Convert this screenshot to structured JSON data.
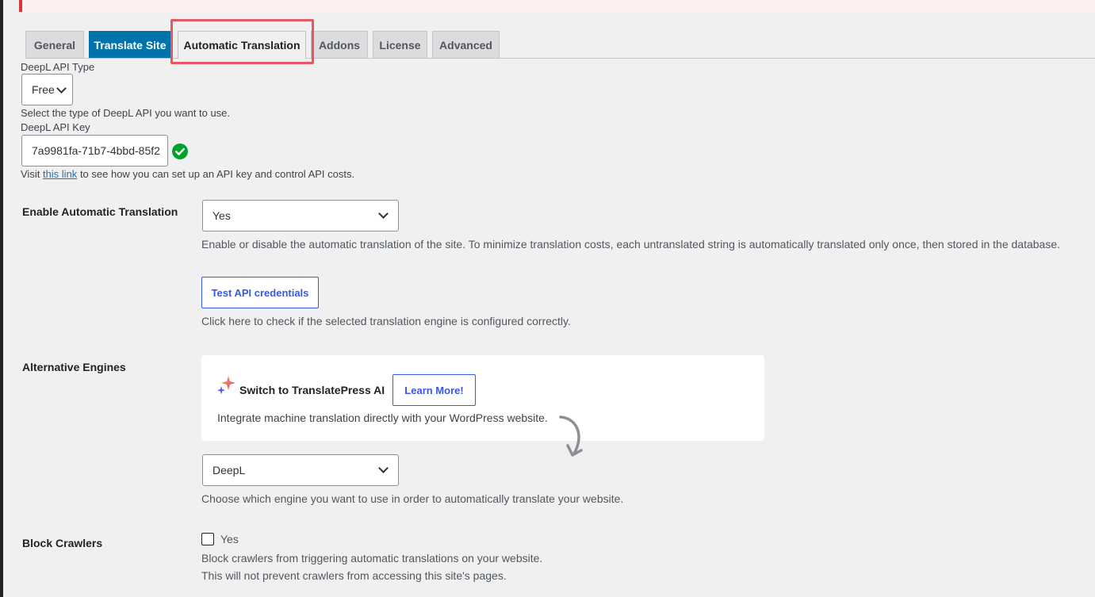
{
  "tabs": [
    {
      "label": "General"
    },
    {
      "label": "Translate Site"
    },
    {
      "label": "Automatic Translation"
    },
    {
      "label": "Addons"
    },
    {
      "label": "License"
    },
    {
      "label": "Advanced"
    }
  ],
  "active_tab": "Automatic Translation",
  "colors": {
    "accent": "#0073aa",
    "highlight": "#e65762",
    "button": "#3858e9",
    "success": "#00a32a"
  },
  "deepl": {
    "api_type_label": "DeepL API Type",
    "api_type_value": "Free",
    "api_type_help": "Select the type of DeepL API you want to use.",
    "api_key_label": "DeepL API Key",
    "api_key_value": "7a9981fa-71b7-4bbd-85f2",
    "help_prefix": "Visit",
    "help_link": "this link",
    "help_suffix": "to see how you can set up an API key and control API costs."
  },
  "enable_auto": {
    "label": "Enable Automatic Translation",
    "value": "Yes",
    "description": "Enable or disable the automatic translation of the site. To minimize translation costs, each untranslated string is automatically translated only once, then stored in the database.",
    "test_button": "Test API credentials",
    "test_description": "Click here to check if the selected translation engine is configured correctly."
  },
  "alt_engines": {
    "label": "Alternative Engines",
    "card_title": "Switch to TranslatePress AI",
    "card_button": "Learn More!",
    "card_description": "Integrate machine translation directly with your WordPress website.",
    "engine_value": "DeepL",
    "engine_description": "Choose which engine you want to use in order to automatically translate your website."
  },
  "block_crawlers": {
    "label": "Block Crawlers",
    "checkbox_label": "Yes",
    "checked": false,
    "description_1": "Block crawlers from triggering automatic translations on your website.",
    "description_2": "This will not prevent crawlers from accessing this site's pages."
  }
}
